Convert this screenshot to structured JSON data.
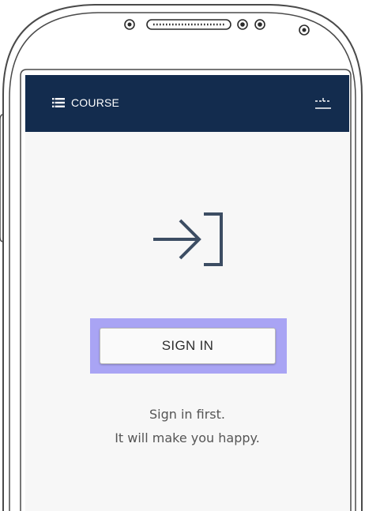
{
  "app_bar": {
    "title": "COURSE",
    "background": "#132c4e",
    "menu_icon": "list-menu-icon",
    "filter_icon": "filter-sliders-icon"
  },
  "main": {
    "login_icon": "sign-in-arrow-icon",
    "signin_label": "SIGN IN",
    "highlight_color": "#a9a4f4",
    "message_line1": "Sign in first.",
    "message_line2": "It will make you happy."
  }
}
